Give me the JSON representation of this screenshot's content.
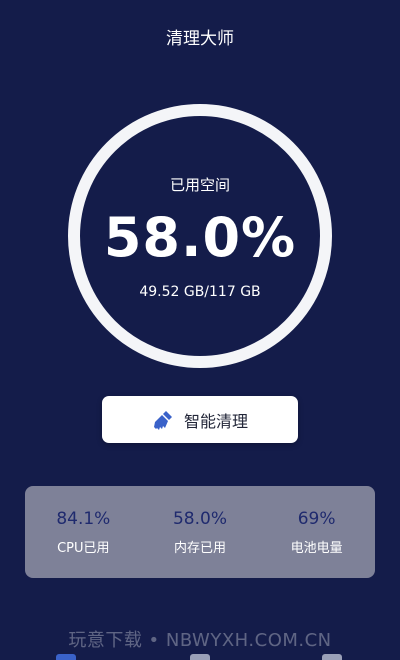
{
  "header": {
    "title": "清理大师"
  },
  "storage": {
    "label": "已用空间",
    "percent_text": "58.0%",
    "detail": "49.52 GB/117 GB",
    "used_fraction": 0.58
  },
  "clean_button": {
    "label": "智能清理",
    "icon": "broom-icon"
  },
  "stats": [
    {
      "value": "84.1%",
      "label": "CPU已用"
    },
    {
      "value": "58.0%",
      "label": "内存已用"
    },
    {
      "value": "69%",
      "label": "电池电量"
    }
  ],
  "watermark": "玩意下载 • NBWYXH.COM.CN",
  "colors": {
    "background": "#141c4a",
    "ring": "#f4f5f8",
    "stats_panel": "#7e8198",
    "stat_value": "#1f2a6e",
    "button_icon": "#3a62c9"
  }
}
